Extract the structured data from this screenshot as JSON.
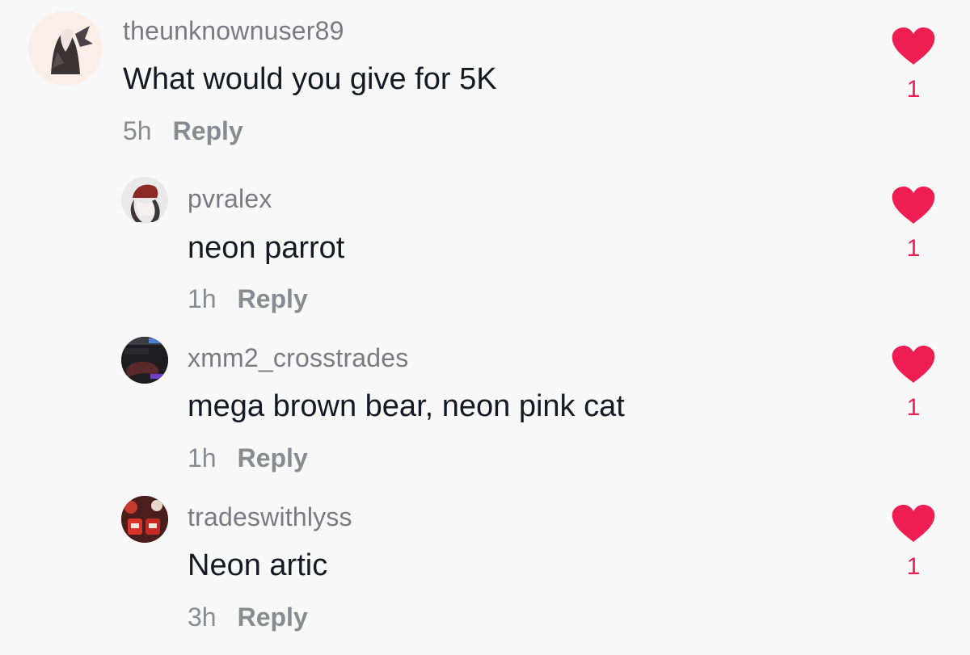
{
  "colors": {
    "background": "#f8f8f8",
    "username": "#7a7a80",
    "text": "#161823",
    "meta": "#8a8b91",
    "heart": "#ee1d52"
  },
  "comments": [
    {
      "username": "theunknownuser89",
      "text": "What would you give for 5K",
      "time": "5h",
      "reply_label": "Reply",
      "likes": "1",
      "heart_icon": "heart-filled-icon"
    },
    {
      "username": "pvralex",
      "text": "neon parrot",
      "time": "1h",
      "reply_label": "Reply",
      "likes": "1",
      "heart_icon": "heart-filled-icon"
    },
    {
      "username": "xmm2_crosstrades",
      "text": "mega brown bear, neon pink cat",
      "time": "1h",
      "reply_label": "Reply",
      "likes": "1",
      "heart_icon": "heart-filled-icon"
    },
    {
      "username": "tradeswithlyss",
      "text": "Neon artic",
      "time": "3h",
      "reply_label": "Reply",
      "likes": "1",
      "heart_icon": "heart-filled-icon"
    }
  ]
}
